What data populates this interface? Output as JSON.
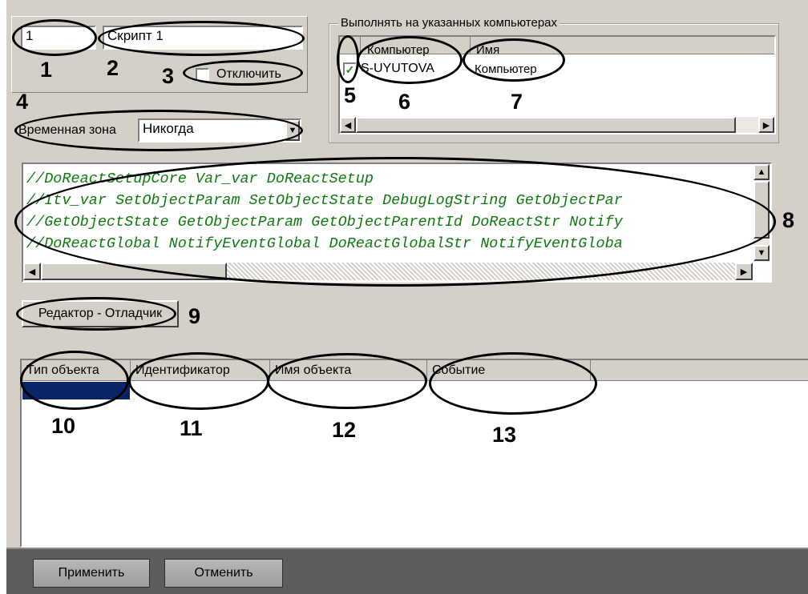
{
  "script": {
    "id_value": "1",
    "name_value": "Скрипт 1",
    "disable_label": "Отключить",
    "disable_checked": false
  },
  "timezone": {
    "label": "Временная зона",
    "value": "Никогда"
  },
  "computers": {
    "group_title": "Выполнять на указанных компьютерах",
    "columns": [
      "Компьютер",
      "Имя"
    ],
    "rows": [
      {
        "checked": true,
        "computer": "S-UYUTOVA",
        "name": "Компьютер"
      }
    ]
  },
  "code_lines": [
    "//DoReactSetupCore Var_var DoReactSetup",
    "//Itv_var SetObjectParam SetObjectState DebugLogString GetObjectPar",
    "//GetObjectState GetObjectParam GetObjectParentId DoReactStr Notify",
    "//DoReactGlobal NotifyEventGlobal DoReactGlobalStr NotifyEventGloba"
  ],
  "editor_button_label": "Редактор - Отладчик",
  "objects_table": {
    "columns": [
      "Тип объекта",
      "Идентификатор",
      "Имя объекта",
      "Событие"
    ],
    "selected_row_color": "#0a246a"
  },
  "callouts": [
    "1",
    "2",
    "3",
    "4",
    "5",
    "6",
    "7",
    "8",
    "9",
    "10",
    "11",
    "12",
    "13"
  ],
  "footer": {
    "apply_label": "Применить",
    "cancel_label": "Отменить"
  },
  "colors": {
    "panel": "#d4d0c8",
    "code_text": "#107a10",
    "footer": "#5d5d5d"
  }
}
